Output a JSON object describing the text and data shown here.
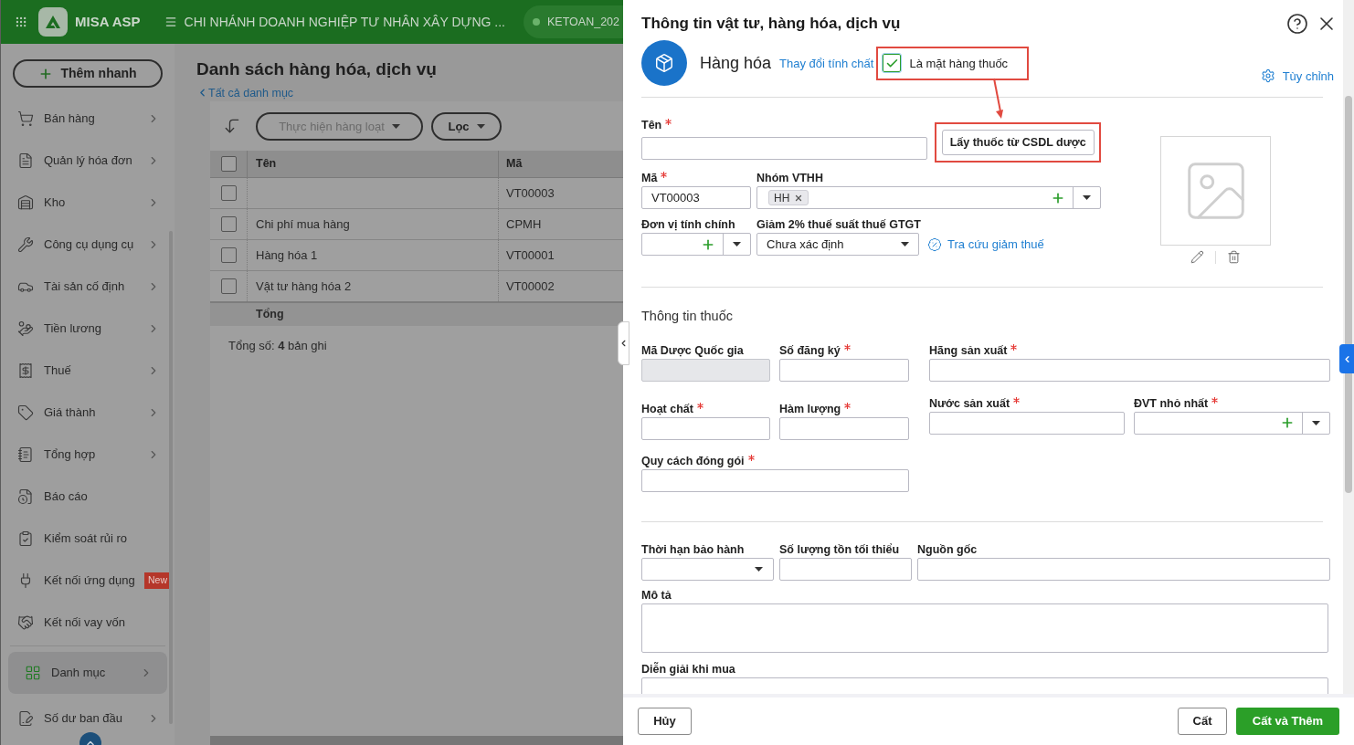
{
  "header": {
    "app_name": "MISA ASP",
    "company": "CHI NHÁNH DOANH NGHIỆP TƯ NHÂN XÂY DỰNG ...",
    "database": "KETOAN_202"
  },
  "sidebar": {
    "quick_add": "Thêm nhanh",
    "items": [
      {
        "label": "Bán hàng",
        "has_submenu": true,
        "selected": false
      },
      {
        "label": "Quản lý hóa đơn",
        "has_submenu": true,
        "selected": false
      },
      {
        "label": "Kho",
        "has_submenu": true,
        "selected": false
      },
      {
        "label": "Công cụ dụng cụ",
        "has_submenu": true,
        "selected": false
      },
      {
        "label": "Tài sản cố định",
        "has_submenu": true,
        "selected": false
      },
      {
        "label": "Tiền lương",
        "has_submenu": true,
        "selected": false
      },
      {
        "label": "Thuế",
        "has_submenu": true,
        "selected": false
      },
      {
        "label": "Giá thành",
        "has_submenu": true,
        "selected": false
      },
      {
        "label": "Tổng hợp",
        "has_submenu": true,
        "selected": false
      },
      {
        "label": "Báo cáo",
        "has_submenu": false,
        "selected": false
      },
      {
        "label": "Kiểm soát rủi ro",
        "has_submenu": false,
        "selected": false
      },
      {
        "label": "Kết nối ứng dụng",
        "has_submenu": false,
        "badge": "New",
        "selected": false
      },
      {
        "label": "Kết nối vay vốn",
        "has_submenu": false,
        "selected": false
      },
      {
        "label": "Danh mục",
        "has_submenu": true,
        "selected": true
      },
      {
        "label": "Số dư ban đầu",
        "has_submenu": true,
        "selected": false
      }
    ]
  },
  "content": {
    "title": "Danh sách hàng hóa, dịch vụ",
    "back_link": "Tất cả danh mục",
    "batch_button": "Thực hiện hàng loạt",
    "filter_button": "Lọc",
    "table": {
      "columns": [
        "Tên",
        "Mã"
      ],
      "rows": [
        {
          "name": "",
          "code": "VT00003",
          "checked": false
        },
        {
          "name": "Chi phí mua hàng",
          "code": "CPMH",
          "checked": false
        },
        {
          "name": "Hàng hóa 1",
          "code": "VT00001",
          "checked": false
        },
        {
          "name": "Vật tư hàng hóa 2",
          "code": "VT00002",
          "checked": false
        }
      ],
      "total_label": "Tổng",
      "header_checked": false
    },
    "record_count": "Tổng số: **4** bản ghi"
  },
  "dialog": {
    "title": "Thông tin vật tư, hàng hóa, dịch vụ",
    "item_type": "Hàng hóa",
    "change_type_link": "Thay đổi tính chất",
    "medicine_checkbox": {
      "label": "Là mặt hàng thuốc",
      "checked": true
    },
    "customize_link": "Tùy chỉnh",
    "fetch_button": "Lấy thuốc từ CSDL dược",
    "name_field": {
      "label": "Tên",
      "required": true
    },
    "code_field": {
      "label": "Mã",
      "required": true,
      "value": "VT00003"
    },
    "group_field": {
      "label": "Nhóm VTHH",
      "required": false,
      "tag": "HH"
    },
    "unit_field": {
      "label": "Đơn vị tính chính",
      "required": false
    },
    "vat_field": {
      "label": "Giảm 2% thuế suất thuế GTGT",
      "required": false,
      "value": "Chưa xác định"
    },
    "tax_lookup_link": "Tra cứu giảm thuế",
    "medicine_section": {
      "title": "Thông tin thuốc",
      "fields": [
        {
          "label": "Mã Dược Quốc gia",
          "required": false,
          "disabled": true
        },
        {
          "label": "Số đăng ký",
          "required": true,
          "disabled": false
        },
        {
          "label": "Hãng sản xuất",
          "required": true,
          "disabled": false
        },
        {
          "label": "Hoạt chất",
          "required": true,
          "disabled": false
        },
        {
          "label": "Hàm lượng",
          "required": true,
          "disabled": false
        },
        {
          "label": "Nước sản xuất",
          "required": true,
          "disabled": false
        },
        {
          "label": "ĐVT nhỏ nhất",
          "required": true,
          "disabled": false
        },
        {
          "label": "Quy cách đóng gói",
          "required": true,
          "disabled": false
        }
      ]
    },
    "warranty_field": {
      "label": "Thời hạn bảo hành",
      "required": false
    },
    "min_stock_field": {
      "label": "Số lượng tồn tối thiểu",
      "required": false
    },
    "origin_field": {
      "label": "Nguồn gốc",
      "required": false
    },
    "description_field": {
      "label": "Mô tả",
      "required": false
    },
    "purchase_note_field": {
      "label": "Diễn giải khi mua",
      "required": false
    },
    "buttons": {
      "cancel": "Hủy",
      "save": "Cất",
      "save_and_add": "Cất và Thêm"
    }
  }
}
